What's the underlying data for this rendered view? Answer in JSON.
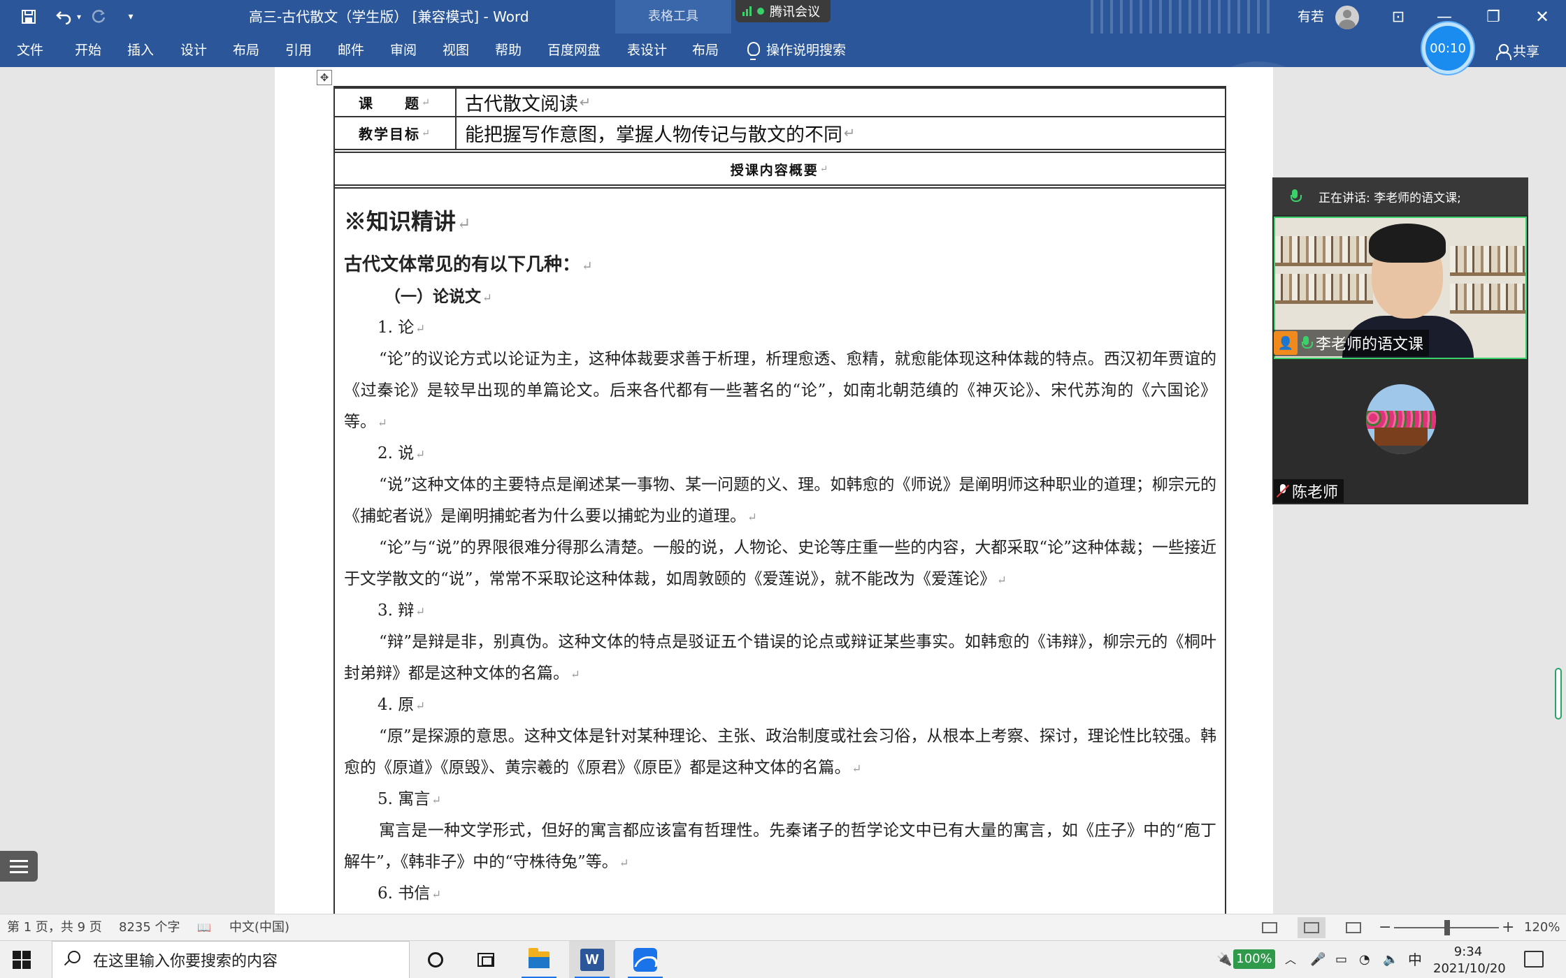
{
  "titlebar": {
    "doc_title": "高三-古代散文（学生版） [兼容模式] - Word",
    "tools_label": "表格工具",
    "meeting_badge": "腾讯会议",
    "user_name": "有若",
    "save_icon": "save-icon",
    "undo_icon": "undo-icon",
    "redo_icon": "redo-icon",
    "qat_icon": "customize-qat-icon",
    "min": "—",
    "max": "❐",
    "close": "✕",
    "ribbon_display": "⊡"
  },
  "ribbon": {
    "tabs": [
      "文件",
      "开始",
      "插入",
      "设计",
      "布局",
      "引用",
      "邮件",
      "审阅",
      "视图",
      "帮助",
      "百度网盘",
      "表设计",
      "布局"
    ],
    "search_label": "操作说明搜索",
    "share_label": "共享",
    "timer": "00:10"
  },
  "document": {
    "topic_label": "课　　题",
    "topic_value": "古代散文阅读",
    "goal_label": "教学目标",
    "goal_value": "能把握写作意图，掌握人物传记与散文的不同",
    "summary_head": "授课内容概要",
    "h1": "※知识精讲",
    "h2": "古代文体常见的有以下几种：",
    "section1": "（一）论说文",
    "item1": "1. 论",
    "p1": "“论”的议论方式以论证为主，这种体裁要求善于析理，析理愈透、愈精，就愈能体现这种体裁的特点。西汉初年贾谊的《过秦论》是较早出现的单篇论文。后来各代都有一些著名的“论”，如南北朝范缜的《神灭论》、宋代苏洵的《六国论》等。",
    "item2": "2.  说",
    "p2": "“说”这种文体的主要特点是阐述某一事物、某一问题的义、理。如韩愈的《师说》是阐明师这种职业的道理；柳宗元的《捕蛇者说》是阐明捕蛇者为什么要以捕蛇为业的道理。",
    "p3": "“论”与“说”的界限很难分得那么清楚。一般的说，人物论、史论等庄重一些的内容，大都采取“论”这种体裁；一些接近于文学散文的“说”，常常不采取论这种体裁，如周敦颐的《爱莲说》，就不能改为《爱莲论》",
    "item3": "3. 辩",
    "p4": "“辩”是辩是非，别真伪。这种文体的特点是驳证五个错误的论点或辩证某些事实。如韩愈的《讳辩》，柳宗元的《桐叶封弟辩》都是这种文体的名篇。",
    "item4": "4. 原",
    "p5": "“原”是探源的意思。这种文体是针对某种理论、主张、政治制度或社会习俗，从根本上考察、探讨，理论性比较强。韩愈的《原道》《原毁》、黄宗羲的《原君》《原臣》都是这种文体的名篇。",
    "item5": "5. 寓言",
    "p6": "寓言是一种文学形式，但好的寓言都应该富有哲理性。先秦诸子的哲学论文中已有大量的寓言，如《庄子》中的“庖丁解牛”，《韩非子》中的“守株待兔”等。",
    "item6": "6. 书信",
    "para_mark": "↵"
  },
  "meeting": {
    "speaking": "正在讲话: 李老师的语文课;",
    "participant1": "李老师的语文课",
    "participant2": "陈老师"
  },
  "statusbar": {
    "page": "第 1 页，共 9 页",
    "words": "8235 个字",
    "lang": "中文(中国)",
    "zoom": "120%",
    "minus": "−",
    "plus": "+"
  },
  "taskbar": {
    "search_placeholder": "在这里输入你要搜索的内容",
    "battery": "100%",
    "ime": "中",
    "time": "9:34",
    "date": "2021/10/20"
  },
  "colors": {
    "ribbon": "#2b579a",
    "accent_green": "#3ad06a",
    "timer_blue": "#1a8cf0"
  }
}
